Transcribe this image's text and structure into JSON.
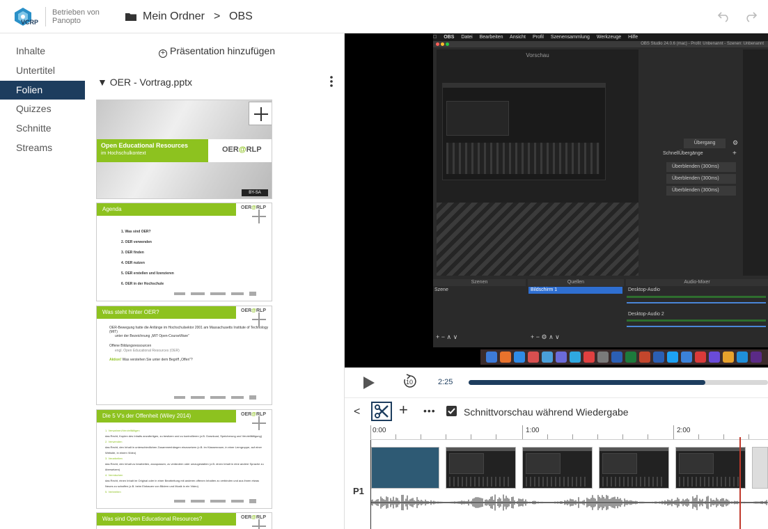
{
  "header": {
    "logo_text": "VCRP",
    "powered_by": "Betrieben von Panopto",
    "breadcrumb_folder": "Mein Ordner",
    "breadcrumb_sep": ">",
    "breadcrumb_current": "OBS"
  },
  "sidebar": {
    "items": [
      {
        "label": "Inhalte",
        "active": false
      },
      {
        "label": "Untertitel",
        "active": false
      },
      {
        "label": "Folien",
        "active": true
      },
      {
        "label": "Quizzes",
        "active": false
      },
      {
        "label": "Schnitte",
        "active": false
      },
      {
        "label": "Streams",
        "active": false
      }
    ]
  },
  "slides": {
    "add_presentation": "Präsentation hinzufügen",
    "deck_title": "OER - Vortrag.pptx",
    "slide1": {
      "title": "Open Educational Resources",
      "subtitle": "im Hochschulkontext",
      "logo_pre": "OER",
      "logo_at": "@",
      "logo_post": "RLP",
      "license": "BY-SA"
    },
    "slide2": {
      "title": "Agenda",
      "items": [
        "1.  Was sind OER?",
        "2.  OER verwenden",
        "3.  OER finden",
        "4.  OER nutzen",
        "5.  OER erstellen und lizenzieren",
        "6.  OER in der Hochschule"
      ]
    },
    "slide3": {
      "title": "Was steht hinter OER?",
      "line1": "OER-Bewegung hatte die Anfänge im Hochschulsektor 2001 am Massachusetts Institute of Technology (MIT)",
      "line2": "unter der Bezeichnung „MIT Open-CourseWare“",
      "line3": "Offene Bildungsressourcen",
      "line4": "engl. Open Educational Resources (OER)",
      "line5_strong": "Aktion!",
      "line5": "Was verstehen Sie unter dem Begriff „Offen“?"
    },
    "slide4": {
      "title": "Die 5 V's der Offenheit (Wiley 2014)",
      "lines": [
        "1.   Verwahren/Vervielfältigen",
        "das Recht, Kopien des Inhalts anzufertigen, zu besitzen und zu kontrollieren (z.B. Download, Speicherung und Vervielfältigung)",
        "2.   Verwenden",
        "das Recht, den Inhalt in unterschiedlichen Zusammenhängen einzusetzen (z.B. im Klassenraum, in einer Lerngruppe, auf einer",
        "Website, in einem Video)",
        "3.   Verarbeiten",
        "das Recht, den Inhalt zu bearbeiten, anzupassen, zu verändern oder umzugestalten (z.B. einen Inhalt in eine andere Sprache zu",
        "übersetzen)",
        "4.   Vermischen",
        "das Recht, einen Inhalt im Original oder in einer Bearbeitung mit anderen offenen Inhalten zu verbinden und aus ihnen etwas",
        "Neues zu schaffen (z.B. beim Einbauen von Bildern und Musik in ein Video)",
        "5.   Verbreiten"
      ]
    },
    "slide5": {
      "title": "Was sind Open Educational Resources?"
    }
  },
  "video": {
    "menubar": [
      "OBS",
      "Datei",
      "Bearbeiten",
      "Ansicht",
      "Profil",
      "Szenensammlung",
      "Werkzeuge",
      "Hilfe"
    ],
    "window_title": "OBS Studio 24.0.6 (mac) - Profil: Unbenannt - Szenen: Unbenannt",
    "preview_label": "Vorschau",
    "transition": "Übergang",
    "quick_transitions": "SchnellÜbergänge",
    "fade_items": [
      "Überblenden (300ms)",
      "Überblenden (300ms)",
      "Überblenden (300ms)"
    ],
    "docks": {
      "scenes": "Szenen",
      "sources": "Quellen",
      "mixer": "Audio-Mixer",
      "scene_item": "Szene",
      "source_item": "Bildschirm 1",
      "desktop_audio": "Desktop-Audio",
      "desktop_audio2": "Desktop-Audio 2"
    }
  },
  "player": {
    "rewind_seconds": "10",
    "current_time": "2:25",
    "progress_fraction": 0.79
  },
  "editor": {
    "preview_checkbox_label": "Schnittvorschau während Wiedergabe",
    "preview_checked": true,
    "track_label": "P1",
    "ruler_labels": [
      "0:00",
      "1:00",
      "2:00"
    ]
  },
  "colors": {
    "navy": "#1d3d5e",
    "slide_green": "#8dc21f",
    "playhead": "#c0392b"
  }
}
